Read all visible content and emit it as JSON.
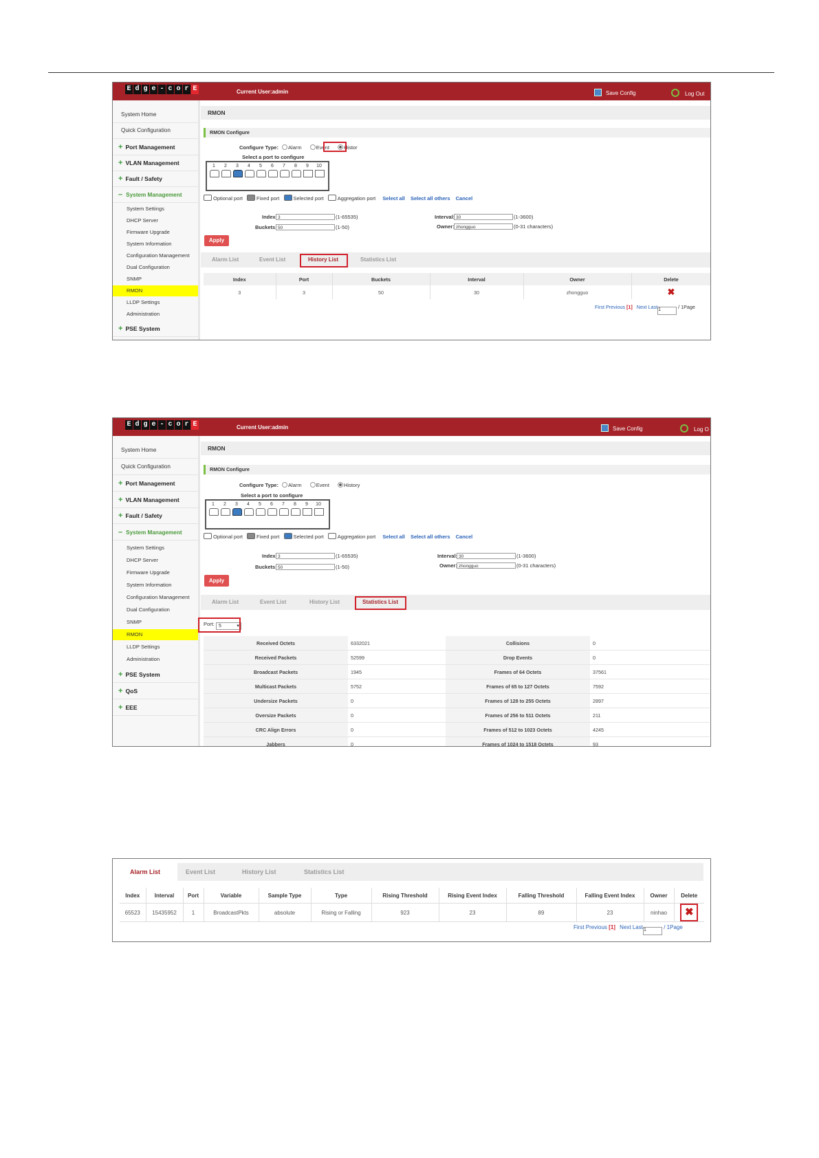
{
  "header": {
    "logo_letters": [
      "E",
      "d",
      "g",
      "e",
      "-",
      "c",
      "o",
      "r",
      "E"
    ],
    "current_user": "Current User:admin",
    "save_config": "Save Config",
    "log_out": "Log Out",
    "log_out_cut": "Log O"
  },
  "sidebar": {
    "system_home": "System Home",
    "quick_config": "Quick Configuration",
    "port_mgmt": "Port Management",
    "vlan_mgmt": "VLAN Management",
    "fault_safety": "Fault / Safety",
    "system_mgmt": "System Management",
    "subs": [
      "System Settings",
      "DHCP Server",
      "Firmware Upgrade",
      "System Information",
      "Configuration Management",
      "Dual Configuration",
      "SNMP",
      "RMON",
      "LLDP Settings",
      "Administration"
    ],
    "pse_system": "PSE System",
    "qos": "QoS",
    "eee": "EEE"
  },
  "rmon": {
    "title": "RMON",
    "configure_bar": "RMON Configure",
    "configure_type_label": "Configure Type:",
    "type_alarm": "Alarm",
    "type_event": "Event",
    "type_history": "History",
    "type_history_cut": "Histor",
    "select_port": "Select a port to configure",
    "ports": [
      "1",
      "2",
      "3",
      "4",
      "5",
      "6",
      "7",
      "8",
      "9",
      "10"
    ],
    "selected_port": "3",
    "legend": {
      "optional": "Optional port",
      "fixed": "Fixed port",
      "selected": "Selected port",
      "aggregation": "Aggregation port",
      "select_all": "Select all",
      "select_others": "Select all others",
      "cancel": "Cancel"
    },
    "form": {
      "index_label": "Index:",
      "index_value": "3",
      "index_range": "(1-65535)",
      "buckets_label": "Buckets:",
      "buckets_value": "50",
      "buckets_range": "(1-50)",
      "interval_label": "Interval:",
      "interval_value": "30",
      "interval_range": "(1-3600)",
      "owner_label": "Owner:",
      "owner_value": "zhongguo",
      "owner_range": "(0-31 characters)"
    },
    "apply": "Apply",
    "tabs": [
      "Alarm List",
      "Event List",
      "History List",
      "Statistics List"
    ]
  },
  "history_table": {
    "headers": [
      "Index",
      "Port",
      "Buckets",
      "Interval",
      "Owner",
      "Delete"
    ],
    "rows": [
      [
        "3",
        "3",
        "50",
        "30",
        "zhongguo"
      ]
    ]
  },
  "pager": {
    "first": "First",
    "previous": "Previous",
    "current": "[1]",
    "next": "Next",
    "last": "Last",
    "page_input": "1",
    "suffix": "/ 1Page"
  },
  "statistics": {
    "port_label": "Port:",
    "port_value": "5",
    "left": [
      [
        "Received Octets",
        "6332021"
      ],
      [
        "Received Packets",
        "52599"
      ],
      [
        "Broadcast Packets",
        "1945"
      ],
      [
        "Multicast Packets",
        "5752"
      ],
      [
        "Undersize Packets",
        "0"
      ],
      [
        "Oversize Packets",
        "0"
      ],
      [
        "CRC Align Errors",
        "0"
      ],
      [
        "Jabbers",
        "0"
      ]
    ],
    "right": [
      [
        "Collisions",
        "0"
      ],
      [
        "Drop Events",
        "0"
      ],
      [
        "Frames of 64 Octets",
        "37561"
      ],
      [
        "Frames of 65 to 127 Octets",
        "7592"
      ],
      [
        "Frames of 128 to 255 Octets",
        "2897"
      ],
      [
        "Frames of 256 to 511 Octets",
        "211"
      ],
      [
        "Frames of 512 to 1023 Octets",
        "4245"
      ],
      [
        "Frames of 1024 to 1518 Octets",
        "93"
      ]
    ]
  },
  "alarm_table": {
    "headers": [
      "Index",
      "Interval",
      "Port",
      "Variable",
      "Sample Type",
      "Type",
      "Rising Threshold",
      "Rising Event Index",
      "Falling Threshold",
      "Falling Event Index",
      "Owner",
      "Delete"
    ],
    "rows": [
      [
        "65523",
        "15435952",
        "1",
        "BroadcastPkts",
        "absolute",
        "Rising or Falling",
        "923",
        "23",
        "89",
        "23",
        "ninhao"
      ]
    ]
  }
}
